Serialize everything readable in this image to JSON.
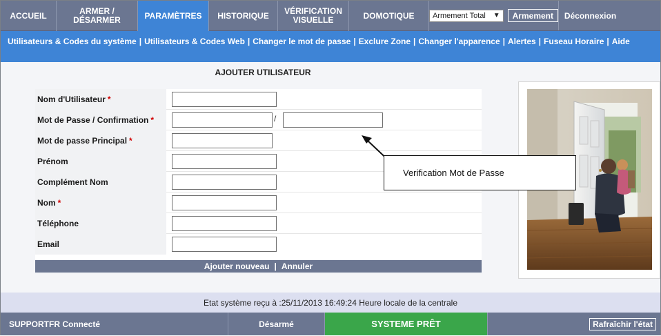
{
  "nav": {
    "accueil": "ACCUEIL",
    "armer_line1": "ARMER /",
    "armer_line2": "DÉSARMER",
    "parametres": "PARAMÈTRES",
    "historique": "HISTORIQUE",
    "verif_line1": "VÉRIFICATION",
    "verif_line2": "VISUELLE",
    "domotique": "DOMOTIQUE",
    "arm_mode_value": "Armement Total",
    "arm_button": "Armement",
    "logout": "Déconnexion",
    "accent": "#3e84d6",
    "bar_color": "#6b7691"
  },
  "subnav": {
    "links": [
      "Utilisateurs & Codes du système",
      "Utilisateurs & Codes Web",
      "Changer le mot de passe",
      "Exclure Zone",
      "Changer l'apparence",
      "Alertes",
      "Fuseau Horaire",
      "Aide"
    ],
    "separator": "|"
  },
  "form": {
    "title": "AJOUTER UTILISATEUR",
    "required_mark": "*",
    "fields": {
      "username": "Nom d'Utilisateur",
      "password": "Mot de Passe / Confirmation",
      "master_password": "Mot de passe Principal",
      "first_name": "Prénom",
      "name_complement": "Complément Nom",
      "last_name": "Nom",
      "phone": "Téléphone",
      "email": "Email"
    },
    "confirm_separator": "/",
    "add_new": "Ajouter nouveau",
    "cancel": "Annuler",
    "action_separator": "|"
  },
  "callout": {
    "text": "Verification Mot de Passe"
  },
  "status": {
    "received": "Etat système reçu à :25/11/2013 16:49:24 Heure locale de la centrale",
    "connected_user": "SUPPORTFR Connecté",
    "arm_state": "Désarmé",
    "system_state": "SYSTEME PRÊT",
    "refresh": "Rafraîchir l'état",
    "ready_color": "#3aa64a"
  }
}
